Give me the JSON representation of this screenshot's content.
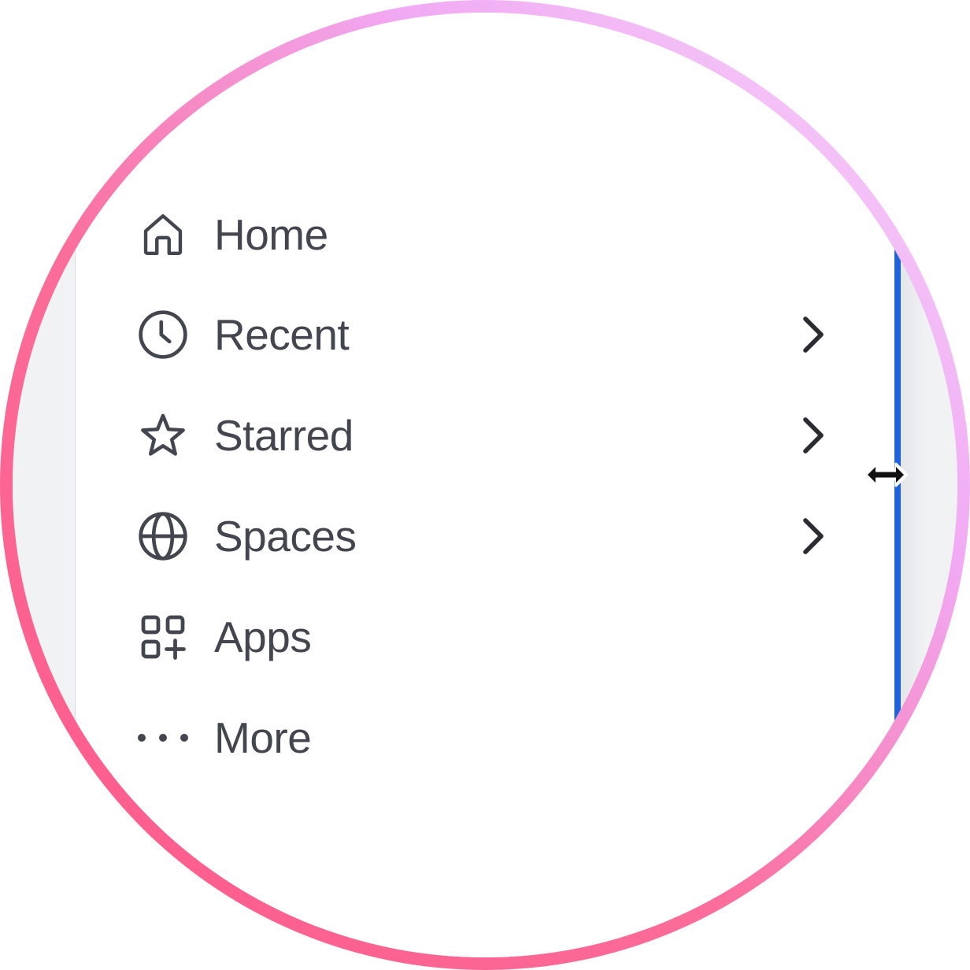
{
  "colors": {
    "ring_start": "#f6d9fb",
    "ring_end": "#fe5887",
    "resize_handle": "#1f63db",
    "text": "#44464f",
    "icon": "#44464f",
    "page_bg": "#f1f2f4"
  },
  "nav": {
    "items": [
      {
        "label": "Home",
        "icon": "home-icon",
        "has_chevron": false
      },
      {
        "label": "Recent",
        "icon": "clock-icon",
        "has_chevron": true
      },
      {
        "label": "Starred",
        "icon": "star-icon",
        "has_chevron": true
      },
      {
        "label": "Spaces",
        "icon": "globe-icon",
        "has_chevron": true
      },
      {
        "label": "Apps",
        "icon": "apps-grid-plus-icon",
        "has_chevron": false
      },
      {
        "label": "More",
        "icon": "more-dots-icon",
        "has_chevron": false
      }
    ]
  },
  "cursor": {
    "icon": "horizontal-resize-cursor-icon"
  }
}
